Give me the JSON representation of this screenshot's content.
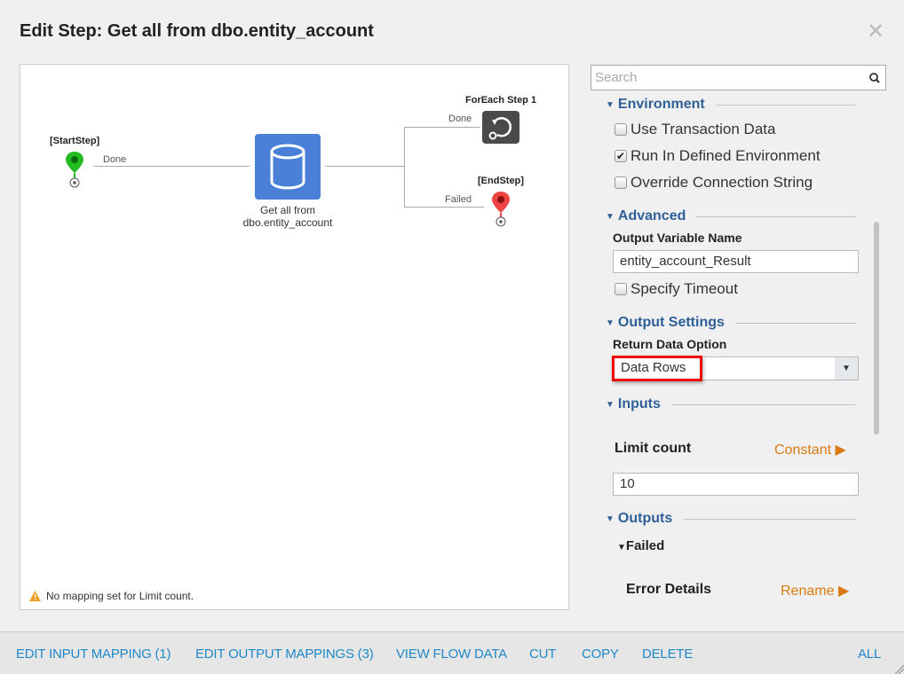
{
  "dialog": {
    "title": "Edit Step: Get all from dbo.entity_account",
    "close_icon": "close-icon"
  },
  "flow": {
    "start_label": "[StartStep]",
    "start_conn": "Done",
    "step_name_line1": "Get all from",
    "step_name_line2": "dbo.entity_account",
    "foreach_label": "ForEach Step 1",
    "done_conn": "Done",
    "end_label": "[EndStep]",
    "failed_conn": "Failed",
    "warning": "No mapping set for Limit count.",
    "colors": {
      "start": "#22bb22",
      "end": "#ee4444",
      "step": "#4a80d8",
      "foreach": "#4a4a4a"
    }
  },
  "panel": {
    "search_placeholder": "Search",
    "environment": {
      "title": "Environment",
      "use_transaction": "Use Transaction Data",
      "run_defined": "Run In Defined Environment",
      "override_conn": "Override Connection String",
      "run_defined_checked": true
    },
    "advanced": {
      "title": "Advanced",
      "output_var_label": "Output Variable Name",
      "output_var_value": "entity_account_Result",
      "specify_timeout": "Specify Timeout"
    },
    "output_settings": {
      "title": "Output Settings",
      "return_label": "Return Data Option",
      "return_value": "Data Rows"
    },
    "inputs": {
      "title": "Inputs",
      "limit_label": "Limit count",
      "limit_mode": "Constant",
      "limit_value": "10"
    },
    "outputs": {
      "title": "Outputs",
      "failed": "Failed",
      "error_details": "Error Details",
      "rename": "Rename"
    }
  },
  "footer": {
    "edit_input": "EDIT INPUT MAPPING (1)",
    "edit_output": "EDIT OUTPUT MAPPINGS (3)",
    "view_flow": "VIEW FLOW DATA",
    "cut": "CUT",
    "copy": "COPY",
    "delete": "DELETE",
    "all": "ALL"
  }
}
